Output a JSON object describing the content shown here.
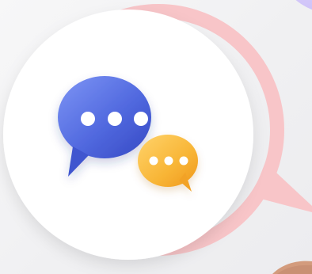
{
  "illustration": {
    "subject": "",
    "colors": {
      "background": "#f1f1f3",
      "ring": "#f9c9cc",
      "card": "#ffffff",
      "lavender": "#d9d0fb",
      "bubble_blue_light": "#6a83ee",
      "bubble_blue_dark": "#3d52c9",
      "bubble_orange_light": "#ffc14e",
      "bubble_orange_dark": "#f39d1f",
      "dot": "#ffffff",
      "hand": "#d39b7d"
    },
    "icons": {
      "primary": "chat-bubble-icon",
      "secondary": "small-chat-bubble-icon"
    }
  }
}
